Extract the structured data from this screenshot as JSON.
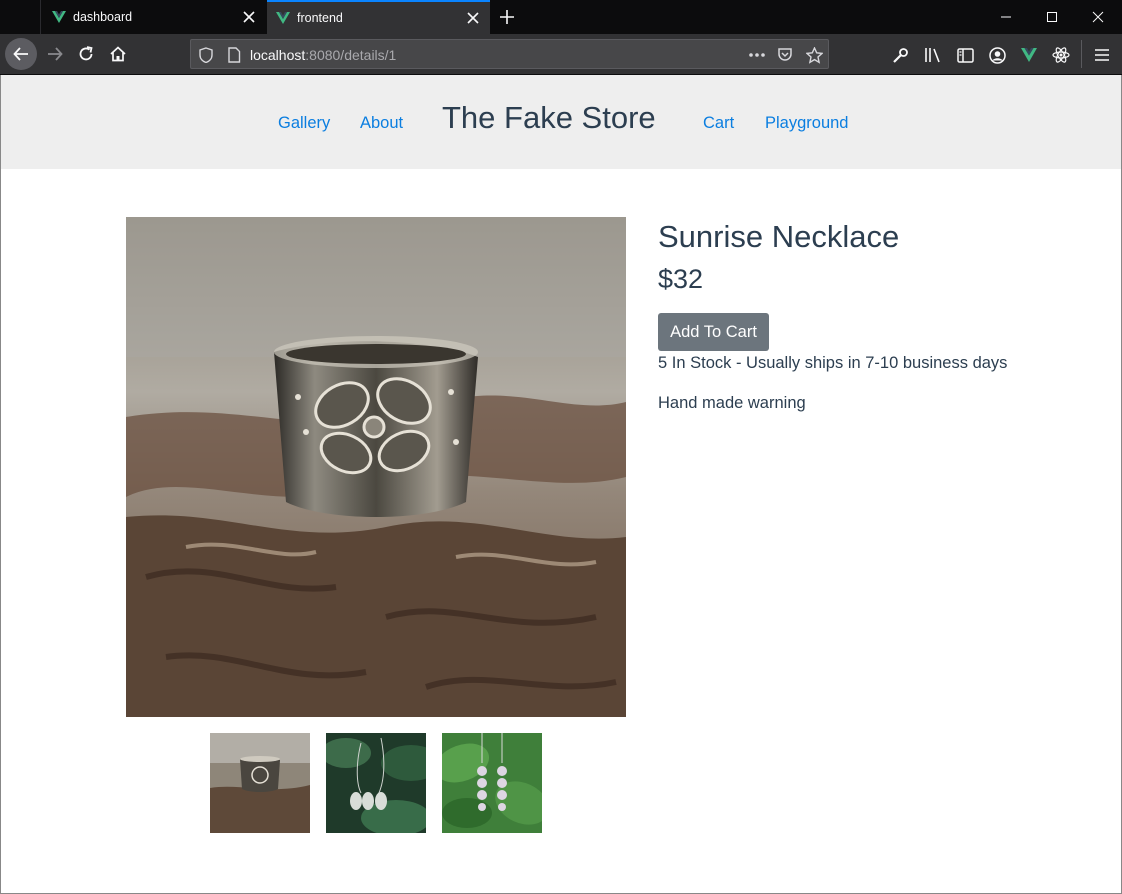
{
  "browser": {
    "tabs": [
      {
        "label": "dashboard"
      },
      {
        "label": "frontend"
      }
    ],
    "url_host": "localhost",
    "url_rest": ":8080/details/1"
  },
  "site": {
    "brand": "The Fake Store",
    "nav_left": [
      "Gallery",
      "About"
    ],
    "nav_right": [
      "Cart",
      "Playground"
    ]
  },
  "product": {
    "title": "Sunrise Necklace",
    "price": "$32",
    "add_to_cart_label": "Add To Cart",
    "stock_text": "5 In Stock - Usually ships in 7-10 business days",
    "description": "Hand made warning",
    "thumbnails": [
      "ring",
      "earrings-hanging",
      "earrings-leaves"
    ]
  },
  "colors": {
    "link": "#0b7ee0",
    "text": "#2c3e50",
    "button": "#6c757d",
    "header_bg": "#eeeeee",
    "vue_green": "#41b883"
  }
}
